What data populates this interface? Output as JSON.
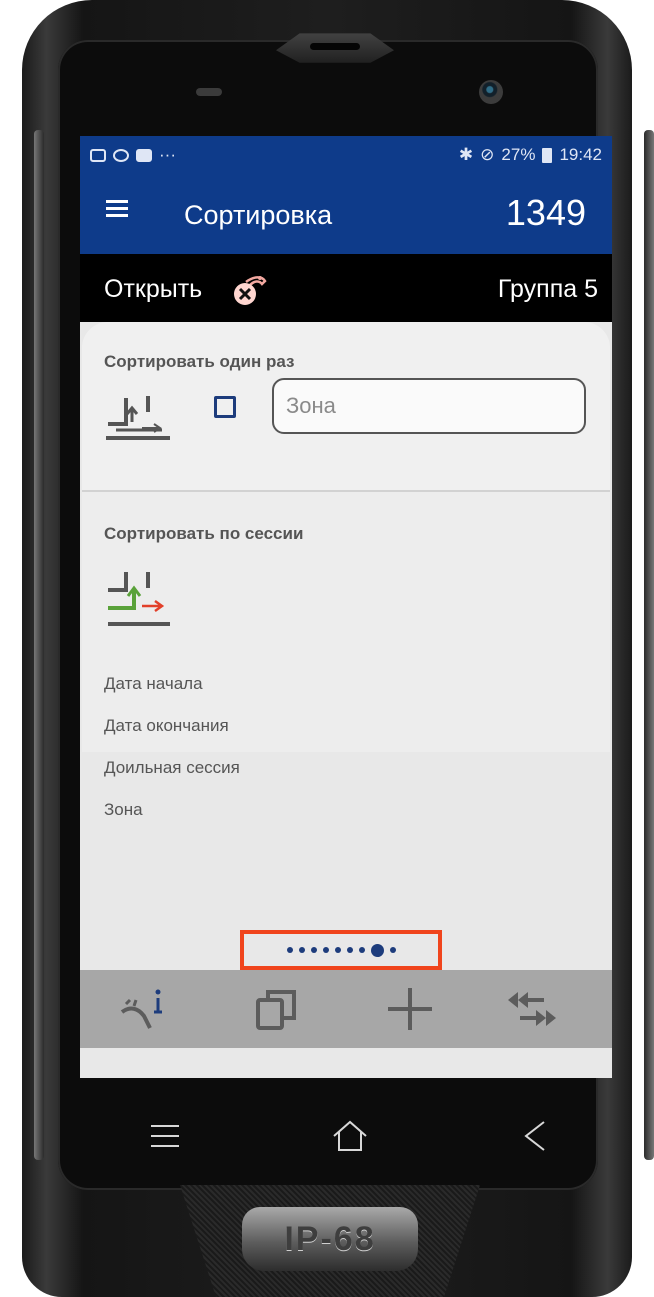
{
  "statusbar": {
    "left_icons": [
      "image-icon",
      "nfc-icon",
      "video-icon",
      "more-icon"
    ],
    "more": "···",
    "bluetooth": "✱",
    "dnd": "⊘",
    "battery": "27%",
    "time": "19:42"
  },
  "appbar": {
    "title": "Сортировка",
    "count": "1349"
  },
  "groupbar": {
    "open_label": "Открыть",
    "group_label": "Группа 5"
  },
  "sort_once": {
    "title": "Сортировать один раз",
    "checkbox_checked": false,
    "zone_placeholder": "Зона"
  },
  "sort_session": {
    "title": "Сортировать по сессии",
    "fields": [
      "Дата начала",
      "Дата окончания",
      "Доильная сессия",
      "Зона"
    ]
  },
  "pager": {
    "total": 9,
    "active_index": 7
  },
  "toolbar": {
    "buttons": [
      "animal-info-icon",
      "copy-icon",
      "add-icon",
      "transfer-icon"
    ]
  },
  "device": {
    "badge": "IP-68"
  },
  "colors": {
    "appbar": "#0e3b8a",
    "groupbar": "#000000",
    "highlight": "#f0441c",
    "dot": "#1d3c7c",
    "toolbar": "#a7a7a7"
  }
}
